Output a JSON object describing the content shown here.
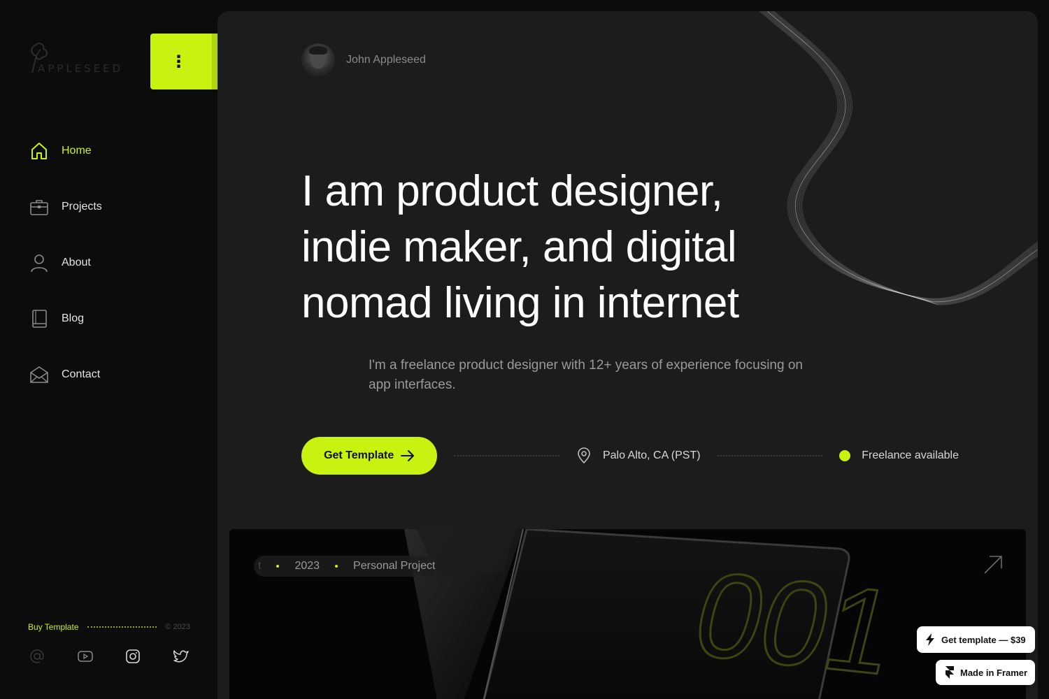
{
  "brand": {
    "logo_text": "APPLESEED",
    "accent_color": "#c8f20f"
  },
  "menu_button": {
    "icon": "vertical-dots-icon",
    "glyph": "⋮"
  },
  "nav": {
    "items": [
      {
        "label": "Home",
        "icon": "home-icon",
        "active": true
      },
      {
        "label": "Projects",
        "icon": "briefcase-icon",
        "active": false
      },
      {
        "label": "About",
        "icon": "user-icon",
        "active": false
      },
      {
        "label": "Blog",
        "icon": "book-icon",
        "active": false
      },
      {
        "label": "Contact",
        "icon": "envelope-icon",
        "active": false
      }
    ]
  },
  "sidebar_footer": {
    "buy_label": "Buy Template",
    "copyright": "© 2023",
    "socials": [
      {
        "icon": "at-icon"
      },
      {
        "icon": "youtube-icon"
      },
      {
        "icon": "instagram-icon"
      },
      {
        "icon": "twitter-icon"
      }
    ]
  },
  "hero": {
    "name": "John Appleseed",
    "headline_lines": [
      "I am product designer,",
      "indie maker, and digital",
      "nomad living in internet"
    ],
    "intro": "I'm a freelance product designer with 12+ years of experience focusing on app interfaces.",
    "cta_label": "Get Template",
    "location": "Palo Alto, CA (PST)",
    "availability": "Freelance available"
  },
  "project_card": {
    "meta_first": "t",
    "year": "2023",
    "type": "Personal Project",
    "number": "001",
    "arrow_icon": "arrow-up-right-icon"
  },
  "badges": {
    "template_label": "Get template — $39",
    "framer_label": "Made in Framer"
  }
}
